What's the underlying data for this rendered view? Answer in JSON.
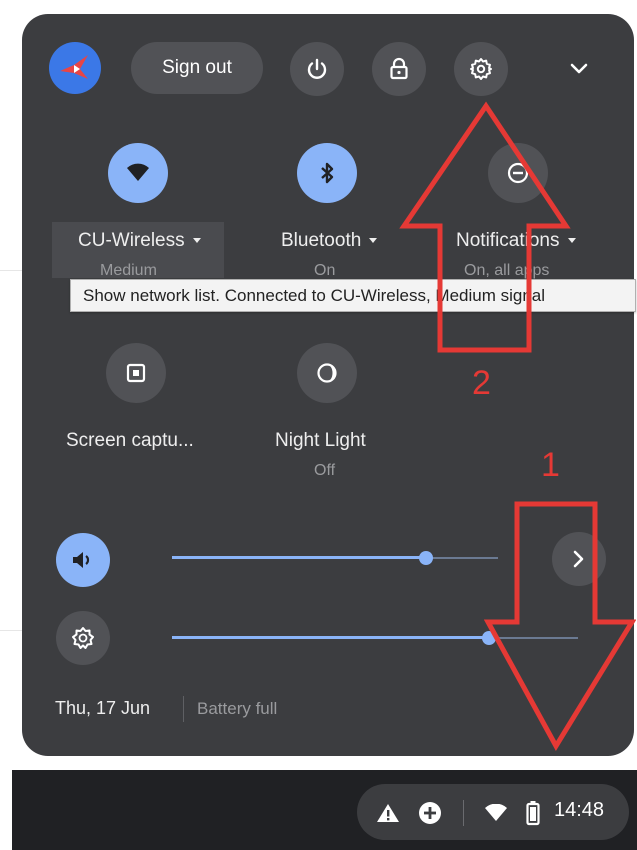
{
  "header": {
    "sign_out_label": "Sign out"
  },
  "toggles": [
    {
      "label": "CU-Wireless",
      "sublabel": "Medium"
    },
    {
      "label": "Bluetooth",
      "sublabel": "On"
    },
    {
      "label": "Notifications",
      "sublabel": "On, all apps"
    }
  ],
  "tooltip": "Show network list. Connected to CU-Wireless, Medium signal",
  "tiles": [
    {
      "label": "Screen captu...",
      "sublabel": ""
    },
    {
      "label": "Night Light",
      "sublabel": "Off"
    }
  ],
  "sliders": {
    "volume_level": 0.78,
    "brightness_level": 0.78
  },
  "footer": {
    "date": "Thu, 17 Jun",
    "battery": "Battery full"
  },
  "shelf": {
    "time": "14:48"
  },
  "annotations": {
    "arrow_1_label": "1",
    "arrow_2_label": "2"
  },
  "colors": {
    "panel": "#3c3d40",
    "accent": "#8ab4f8",
    "annotation": "#e53935"
  }
}
